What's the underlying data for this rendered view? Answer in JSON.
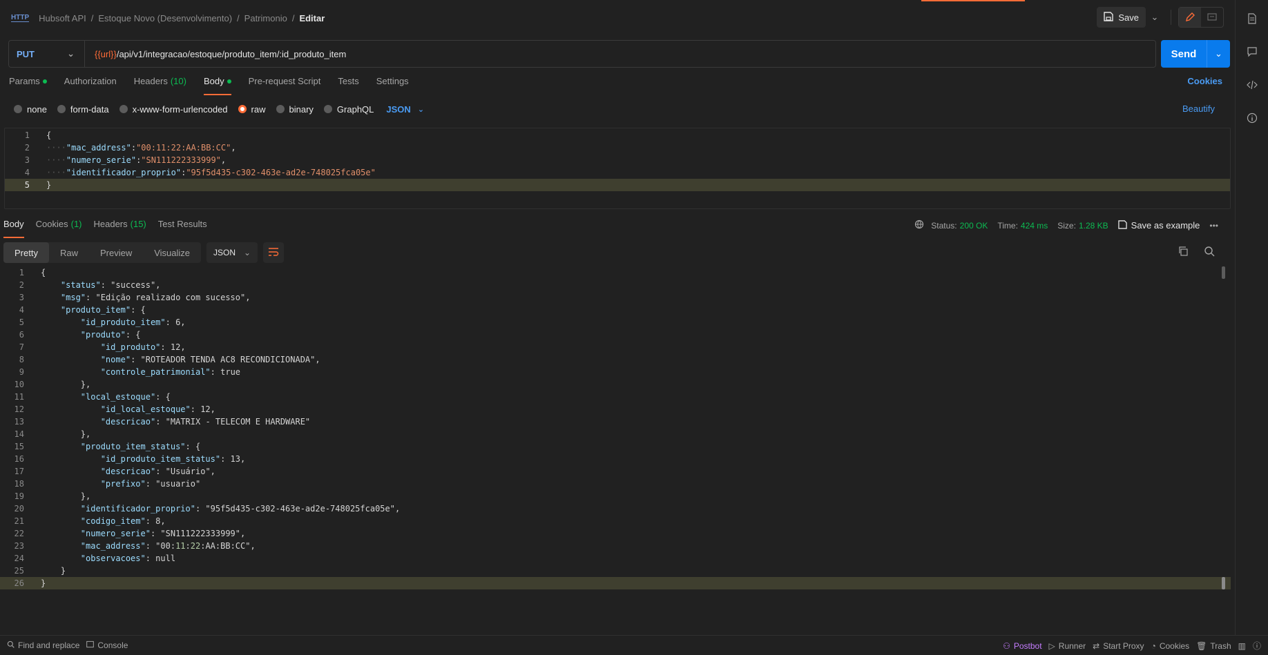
{
  "breadcrumb": {
    "items": [
      "Hubsoft API",
      "Estoque Novo (Desenvolvimento)",
      "Patrimonio"
    ],
    "current": "Editar",
    "icon": "http-icon"
  },
  "header": {
    "save_label": "Save"
  },
  "request": {
    "method": "PUT",
    "url_var": "{{url}}",
    "url_path": "/api/v1/integracao/estoque/produto_item/:id_produto_item",
    "send_label": "Send"
  },
  "req_tabs": [
    {
      "label": "Params",
      "dot": true
    },
    {
      "label": "Authorization"
    },
    {
      "label": "Headers",
      "count": "(10)"
    },
    {
      "label": "Body",
      "dot": true,
      "active": true
    },
    {
      "label": "Pre-request Script"
    },
    {
      "label": "Tests"
    },
    {
      "label": "Settings"
    }
  ],
  "cookies_link": "Cookies",
  "body_types": [
    "none",
    "form-data",
    "x-www-form-urlencoded",
    "raw",
    "binary",
    "GraphQL"
  ],
  "body_format": "JSON",
  "beautify_label": "Beautify",
  "req_body_lines": [
    "{",
    "····\"mac_address\":\"00:11:22:AA:BB:CC\",",
    "····\"numero_serie\":\"SN111222333999\",",
    "····\"identificador_proprio\":\"95f5d435-c302-463e-ad2e-748025fca05e\"",
    "}"
  ],
  "resp_tabs": [
    {
      "label": "Body",
      "active": true
    },
    {
      "label": "Cookies",
      "count": "(1)"
    },
    {
      "label": "Headers",
      "count": "(15)"
    },
    {
      "label": "Test Results"
    }
  ],
  "response_meta": {
    "status_label": "Status:",
    "status": "200 OK",
    "time_label": "Time:",
    "time": "424 ms",
    "size_label": "Size:",
    "size": "1.28 KB",
    "save_example": "Save as example"
  },
  "view_modes": [
    "Pretty",
    "Raw",
    "Preview",
    "Visualize"
  ],
  "resp_format": "JSON",
  "resp_lines": [
    "{",
    "    \"status\": \"success\",",
    "    \"msg\": \"Edição realizado com sucesso\",",
    "    \"produto_item\": {",
    "        \"id_produto_item\": 6,",
    "        \"produto\": {",
    "            \"id_produto\": 12,",
    "            \"nome\": \"ROTEADOR TENDA AC8 RECONDICIONADA\",",
    "            \"controle_patrimonial\": true",
    "        },",
    "        \"local_estoque\": {",
    "            \"id_local_estoque\": 12,",
    "            \"descricao\": \"MATRIX - TELECOM E HARDWARE\"",
    "        },",
    "        \"produto_item_status\": {",
    "            \"id_produto_item_status\": 13,",
    "            \"descricao\": \"Usuário\",",
    "            \"prefixo\": \"usuario\"",
    "        },",
    "        \"identificador_proprio\": \"95f5d435-c302-463e-ad2e-748025fca05e\",",
    "        \"codigo_item\": 8,",
    "        \"numero_serie\": \"SN111222333999\",",
    "        \"mac_address\": \"00:11:22:AA:BB:CC\",",
    "        \"observacoes\": null",
    "    }",
    "}"
  ],
  "footer": {
    "left": [
      "Find and replace",
      "Console"
    ],
    "right": [
      "Postbot",
      "Runner",
      "Start Proxy",
      "Cookies",
      "Trash"
    ]
  },
  "colors": {
    "accent": "#ff6c37",
    "primary": "#097bed",
    "success": "#0cbb52"
  }
}
